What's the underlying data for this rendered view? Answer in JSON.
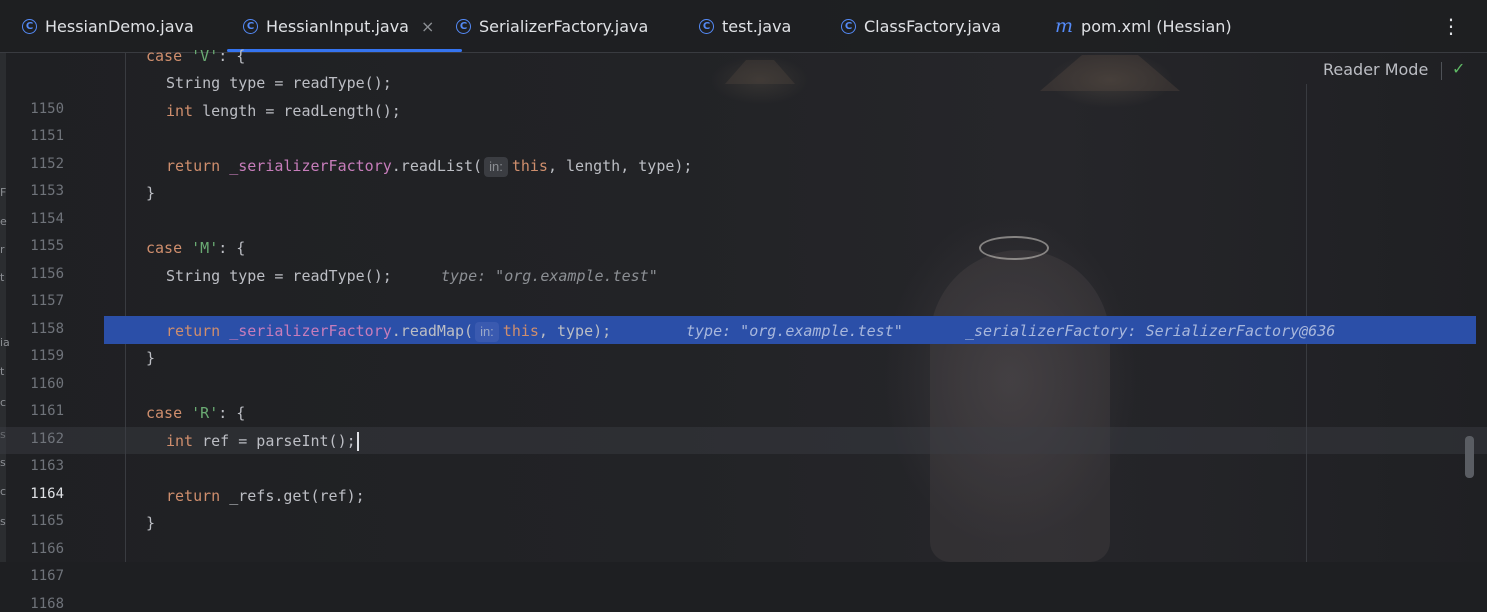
{
  "tabs": [
    {
      "label": "HessianDemo.java",
      "icon": "class-icon",
      "active": false
    },
    {
      "label": "HessianInput.java",
      "icon": "class-icon",
      "active": true,
      "close": "×"
    },
    {
      "label": "SerializerFactory.java",
      "icon": "class-icon",
      "active": false
    },
    {
      "label": "test.java",
      "icon": "class-icon",
      "active": false
    },
    {
      "label": "ClassFactory.java",
      "icon": "class-icon",
      "active": false
    },
    {
      "label": "pom.xml (Hessian)",
      "icon": "maven-icon",
      "active": false
    }
  ],
  "tab_menu": "⋮",
  "reader_mode": "Reader Mode",
  "gutter_fragments": [
    "F",
    "e",
    "r",
    "t",
    "ia",
    "t",
    "c",
    "s",
    "s",
    "c",
    "s"
  ],
  "line_numbers": [
    "1150",
    "1151",
    "1152",
    "1153",
    "1154",
    "1155",
    "1156",
    "1157",
    "1158",
    "1159",
    "1160",
    "1161",
    "1162",
    "1163",
    "1164",
    "1165",
    "1166",
    "1167",
    "1168"
  ],
  "current_line": "1164",
  "execution_line": "1160",
  "code": {
    "l1150": {
      "kw": "case",
      "str": "'V'",
      "rest": ": {"
    },
    "l1151": {
      "text": "String type = readType();"
    },
    "l1152": {
      "kw": "int",
      "rest": " length = readLength();"
    },
    "l1154": {
      "kw": "return",
      "field": "_serializerFactory",
      "call": ".readList(",
      "hint": "in:",
      "this": "this",
      "rest": ", length, type);"
    },
    "l1155": {
      "text": "}"
    },
    "l1157": {
      "kw": "case",
      "str": "'M'",
      "rest": ": {"
    },
    "l1158": {
      "text": "String type = readType();",
      "inline": "type: \"org.example.test\""
    },
    "l1160": {
      "kw": "return",
      "field": "_serializerFactory",
      "call": ".readMap(",
      "hint": "in:",
      "this": "this",
      "rest": ", type);",
      "inline1": "type: \"org.example.test\"",
      "inline2": "_serializerFactory: SerializerFactory@636"
    },
    "l1161": {
      "text": "}"
    },
    "l1163": {
      "kw": "case",
      "str": "'R'",
      "rest": ": {"
    },
    "l1164": {
      "kw": "int",
      "rest": " ref = parseInt();"
    },
    "l1166": {
      "kw": "return",
      "rest": " _refs.get(ref);"
    },
    "l1167": {
      "text": "}"
    }
  },
  "colors": {
    "keyword": "#cf8e6d",
    "string": "#6aab73",
    "field": "#c77dbb",
    "accent": "#3574f0",
    "execution_bg": "#2b4fa8"
  }
}
